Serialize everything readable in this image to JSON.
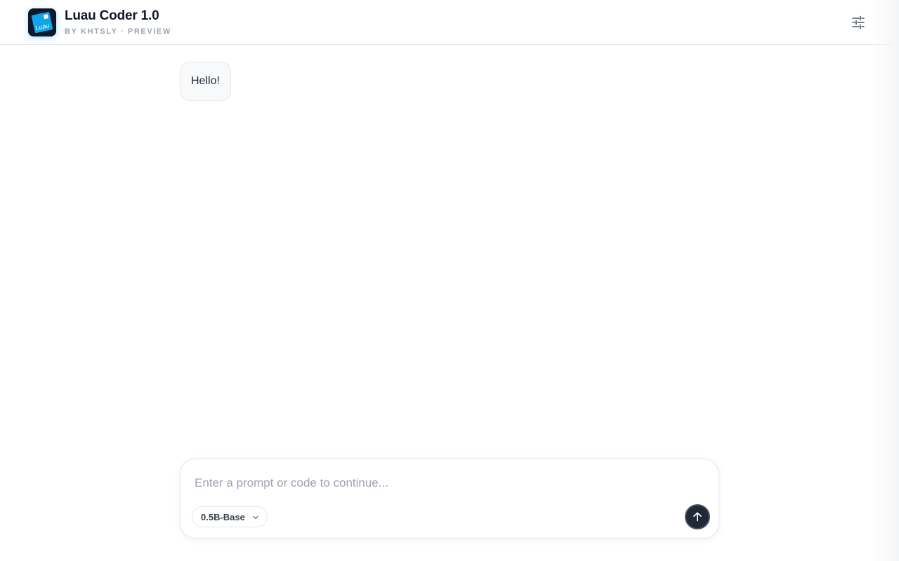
{
  "header": {
    "title": "Luau Coder 1.0",
    "subtitle": "BY KHTSLY · PREVIEW",
    "logo_text": "Luau",
    "logo_icon": "luau-logo-icon",
    "settings_icon": "sliders-icon"
  },
  "conversation": {
    "messages": [
      {
        "role": "user",
        "text": "Hello!"
      }
    ]
  },
  "composer": {
    "placeholder": "Enter a prompt or code to continue...",
    "value": "",
    "model_selected": "0.5B-Base",
    "send_icon": "arrow-up-icon"
  },
  "colors": {
    "logo_blue": "#0ea5e9",
    "send_button": "#1f2937",
    "border": "#e5e7eb"
  }
}
